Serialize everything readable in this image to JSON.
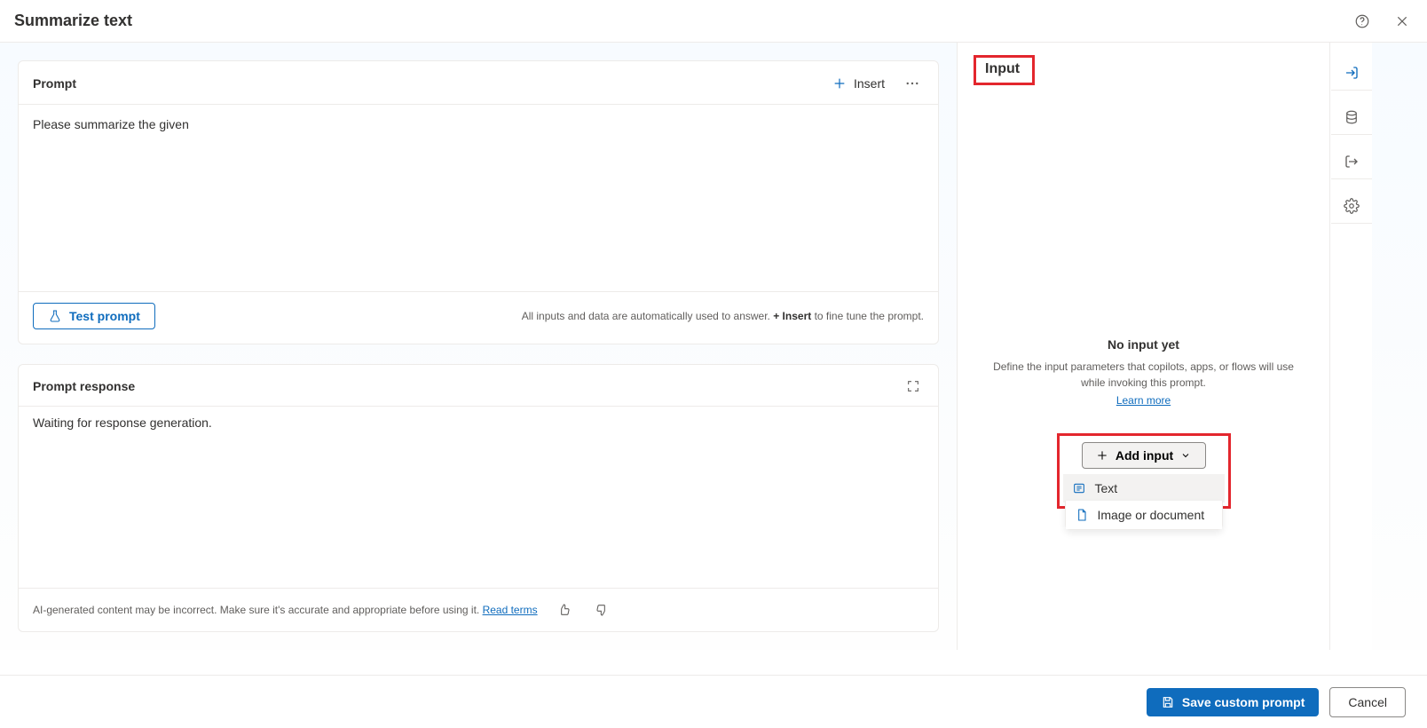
{
  "header": {
    "title": "Summarize text"
  },
  "prompt_card": {
    "title": "Prompt",
    "insert_label": "Insert",
    "body": "Please summarize the given",
    "test_label": "Test prompt",
    "hint_pre": "All inputs and data are automatically used to answer. ",
    "hint_bold": "+ Insert",
    "hint_post": " to fine tune the prompt."
  },
  "response_card": {
    "title": "Prompt response",
    "body": "Waiting for response generation.",
    "disclaimer": "AI-generated content may be incorrect. Make sure it's accurate and appropriate before using it. ",
    "read_terms": "Read terms"
  },
  "right_panel": {
    "heading": "Input",
    "empty_title": "No input yet",
    "empty_desc": "Define the input parameters that copilots, apps, or flows will use while invoking this prompt.",
    "learn_more": "Learn more",
    "add_input_label": "Add input",
    "menu": {
      "text": "Text",
      "image_doc": "Image or document"
    }
  },
  "footer": {
    "save_label": "Save custom prompt",
    "cancel_label": "Cancel"
  }
}
